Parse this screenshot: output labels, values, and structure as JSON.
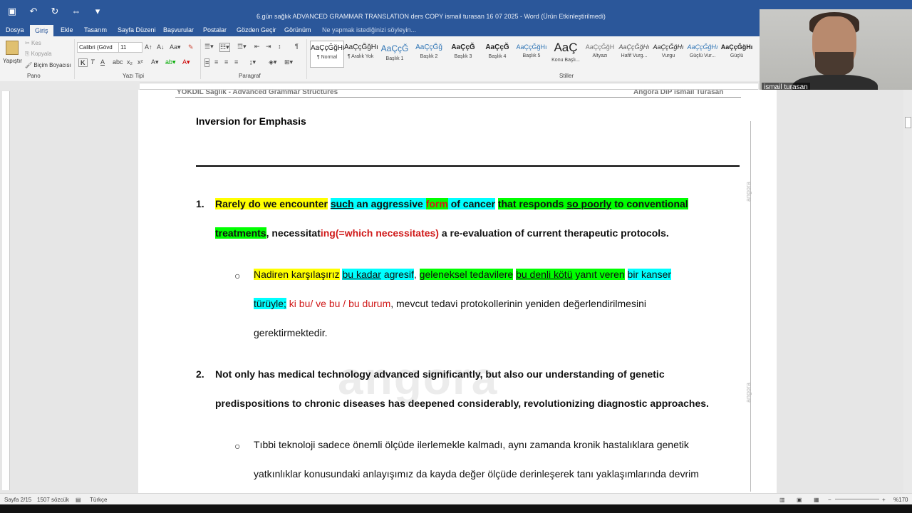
{
  "window": {
    "title": "6.gün sağlık ADVANCED GRAMMAR TRANSLATION ders COPY ismail turasan  16 07  2025 - Word (Ürün Etkinleştirilmedi)"
  },
  "tabs": [
    {
      "label": "Dosya"
    },
    {
      "label": "Giriş"
    },
    {
      "label": "Ekle"
    },
    {
      "label": "Tasarım"
    },
    {
      "label": "Sayfa Düzeni"
    },
    {
      "label": "Başvurular"
    },
    {
      "label": "Postalar"
    },
    {
      "label": "Gözden Geçir"
    },
    {
      "label": "Görünüm"
    }
  ],
  "tell_me": "Ne yapmak istediğinizi söyleyin...",
  "ribbon": {
    "paste": "Yapıştır",
    "cut": "Kes",
    "copy": "Kopyala",
    "format_painter": "Biçim Boyacısı",
    "font_name": "Calibri (Gövd",
    "font_size": "11",
    "bold": "K",
    "italic": "T",
    "underline": "A",
    "groups": {
      "clipboard": "Pano",
      "font": "Yazı Tipi",
      "paragraph": "Paragraf",
      "styles": "Stiller"
    },
    "styles": [
      {
        "preview": "AaÇçĞğHı",
        "name": "¶ Normal"
      },
      {
        "preview": "AaÇçĞğHı",
        "name": "¶ Aralık Yok"
      },
      {
        "preview": "AaÇçĞ",
        "name": "Başlık 1"
      },
      {
        "preview": "AaÇçĞğ",
        "name": "Başlık 2"
      },
      {
        "preview": "AaÇçĞ",
        "name": "Başlık 3"
      },
      {
        "preview": "AaÇçĞ",
        "name": "Başlık 4"
      },
      {
        "preview": "AaÇçĞğHı",
        "name": "Başlık 5"
      },
      {
        "preview": "AaÇ",
        "name": "Konu Başlı..."
      },
      {
        "preview": "AaÇçĞğH",
        "name": "Altyazı"
      },
      {
        "preview": "AaÇçĞğHı",
        "name": "Hafif Vurg..."
      },
      {
        "preview": "AaÇçĞğHı",
        "name": "Vurgu"
      },
      {
        "preview": "AaÇçĞğHı",
        "name": "Güçlü Vur..."
      },
      {
        "preview": "AaÇçĞğHı",
        "name": "Güçlü"
      }
    ]
  },
  "webcam": {
    "participant_name": "ismail turasan"
  },
  "document": {
    "header_left": "YÖKDİL Sağlık - Advanced Grammar Structures",
    "header_right": "Angora DiP ismail Turasan",
    "title": "Inversion for Emphasis",
    "watermark": "angora",
    "item1": {
      "number": "1.",
      "l1": {
        "a": "Rarely do we encounter",
        "b": " ",
        "c": "such",
        "d": " an aggressive ",
        "e": "form",
        "f": " of cancer",
        "g": " ",
        "h": "that responds ",
        "i": "so poorly",
        "j": " to conventional"
      },
      "l2": {
        "a": "treatments",
        "b": ", necessitat",
        "c": "ing(=which necessitates)",
        "d": " a re-evaluation of current therapeutic protocols."
      },
      "translation": {
        "l1": {
          "a": "Nadiren karşılaşırız",
          "b": " ",
          "c": "bu kadar",
          "d": " agresif",
          "e": ", ",
          "f": "geleneksel tedavilere",
          "g": " ",
          "h": "bu denli kötü",
          "i": " yanıt veren",
          "j": " ",
          "k": "bir kanser"
        },
        "l2": {
          "a": "türüyle;",
          "b": " ki bu/ ve bu / bu durum",
          "c": ", mevcut tedavi protokollerinin yeniden değerlendirilmesini"
        },
        "l3": "gerektirmektedir."
      }
    },
    "item2": {
      "number": "2.",
      "l1": "Not only has medical technology advanced significantly, but also our understanding of genetic",
      "l2": "predispositions to chronic diseases has deepened considerably, revolutionizing diagnostic approaches.",
      "translation": {
        "l1": "Tıbbi teknoloji sadece önemli ölçüde ilerlemekle kalmadı, aynı zamanda kronik hastalıklara genetik",
        "l2": "yatkınlıklar konusundaki anlayışımız da kayda değer ölçüde derinleşerek tanı yaklaşımlarında devrim"
      }
    }
  },
  "status": {
    "page": "Sayfa 2/15",
    "words": "1507 sözcük",
    "language": "Türkçe",
    "zoom": "%170"
  }
}
